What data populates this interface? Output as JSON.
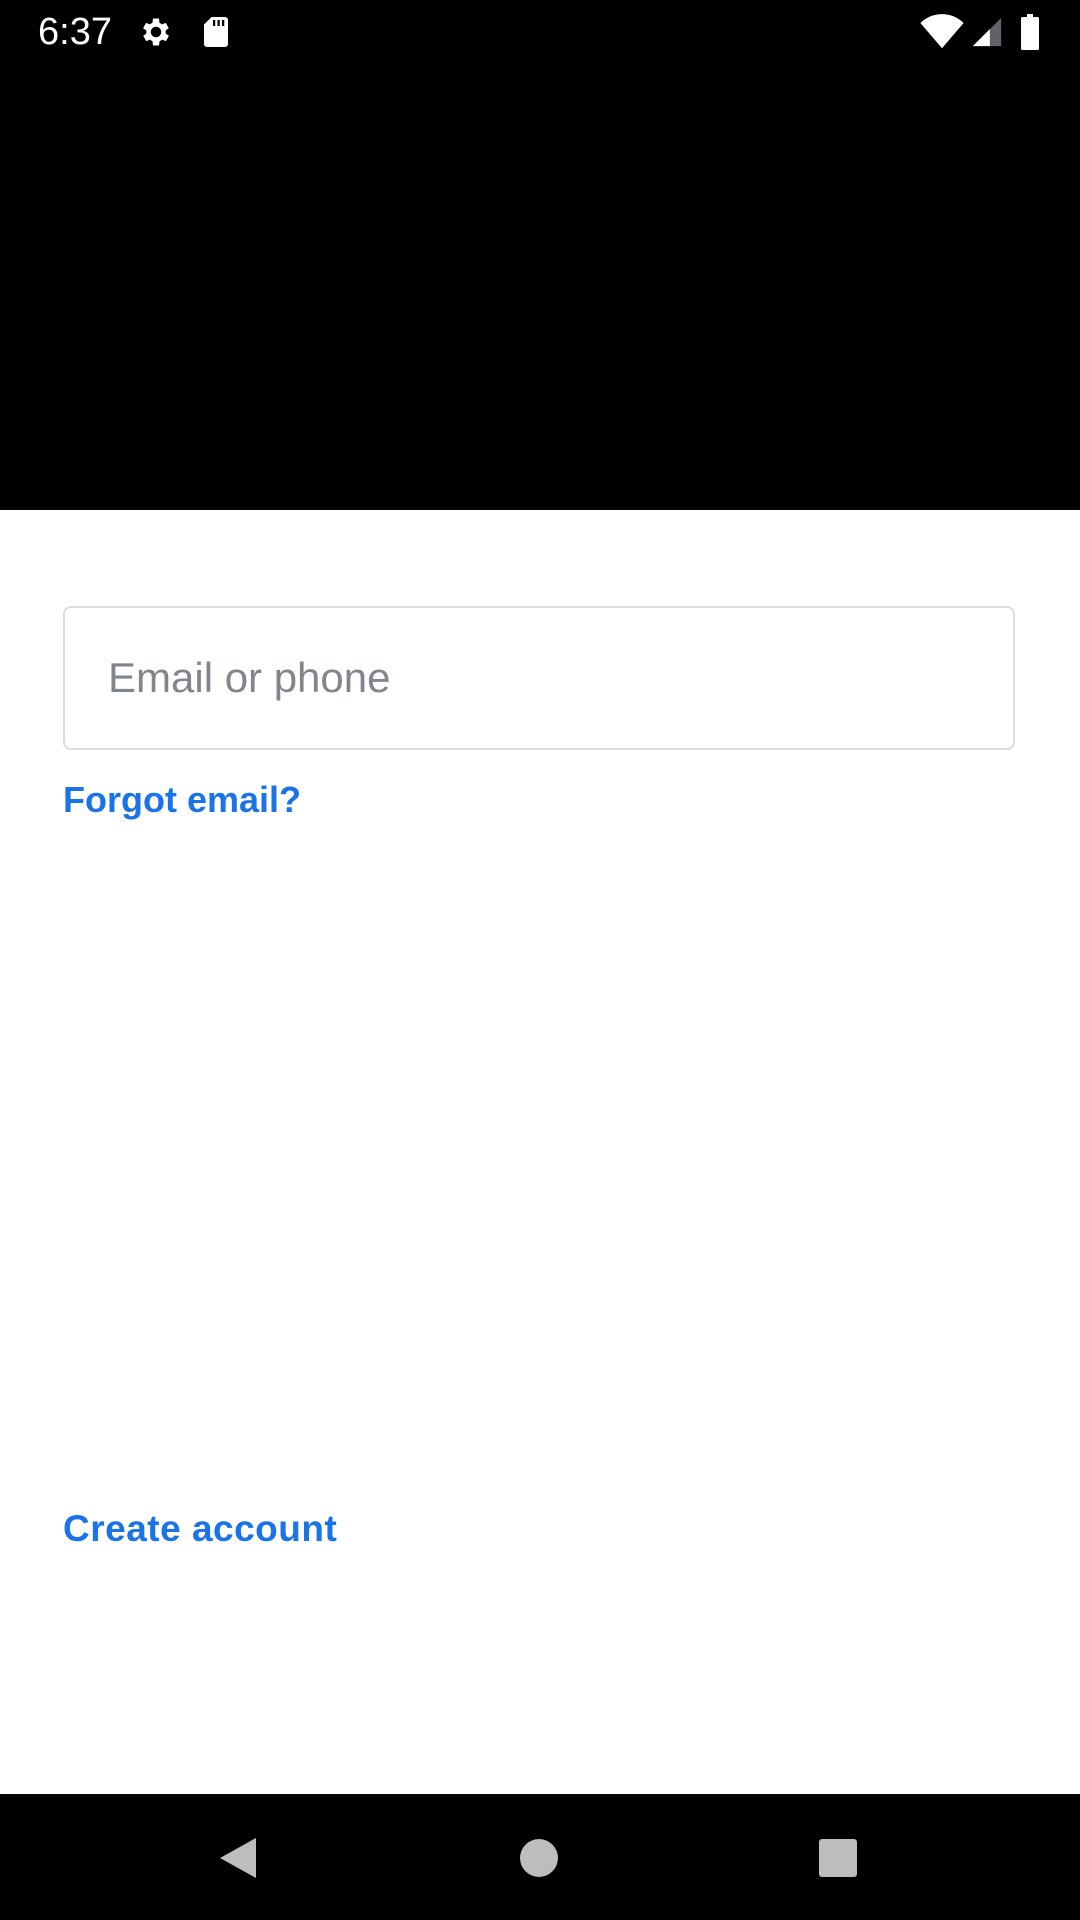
{
  "status_bar": {
    "time": "6:37",
    "icons": [
      "gear-icon",
      "sd-card-icon",
      "wifi-icon",
      "signal-icon",
      "battery-icon"
    ]
  },
  "signin": {
    "email_placeholder": "Email or phone",
    "email_value": "",
    "forgot_email_label": "Forgot email?",
    "create_account_label": "Create account"
  },
  "nav_bar": {
    "icons": [
      "back-icon",
      "home-icon",
      "recents-icon"
    ]
  },
  "colors": {
    "link": "#1a73e8",
    "field_border": "#dadce0",
    "placeholder": "#80868b",
    "header_background": "#000000"
  }
}
